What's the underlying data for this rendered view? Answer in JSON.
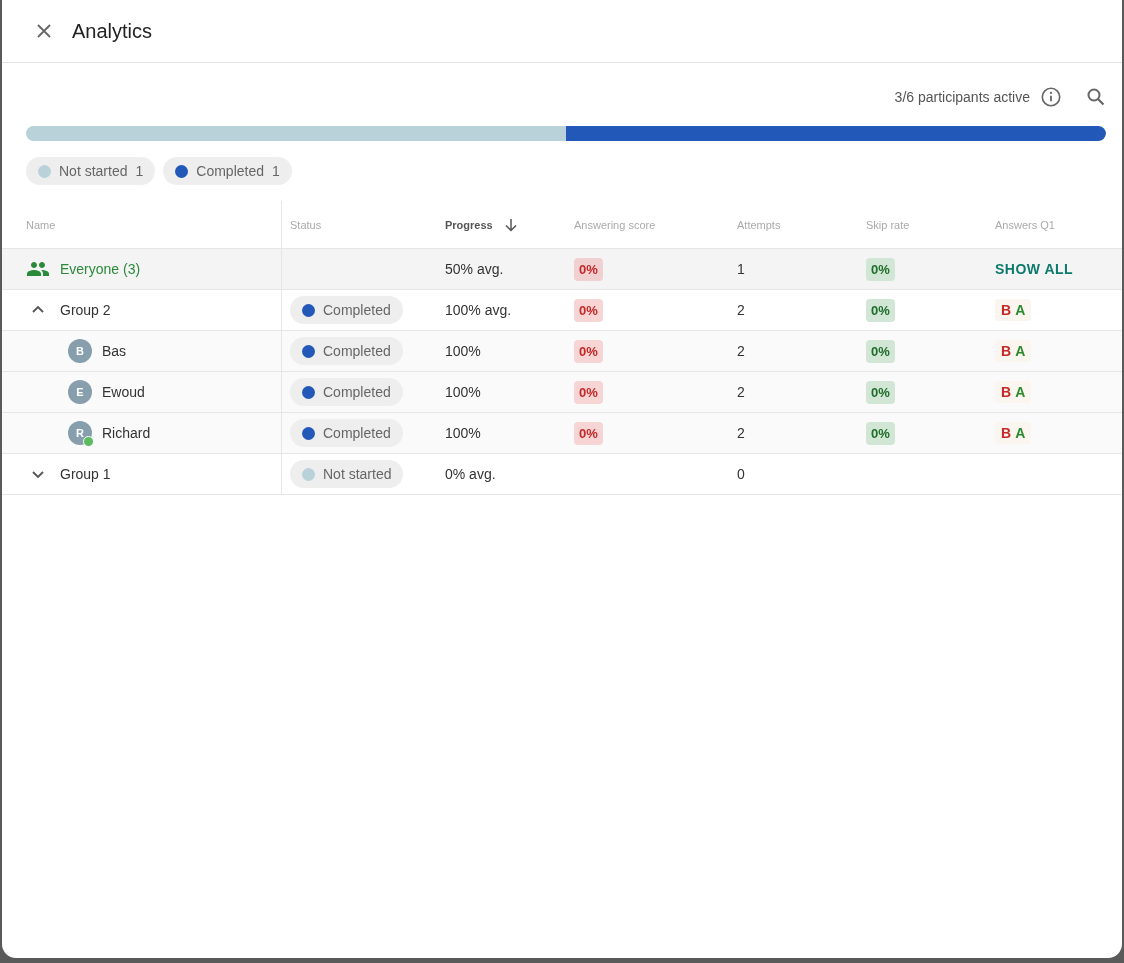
{
  "dialog": {
    "title": "Analytics"
  },
  "participants_active": "3/6 participants active",
  "completed_bar": {
    "level": 0.5
  },
  "legend": [
    {
      "label": "Not started",
      "count": "1",
      "color": "#b9d2da"
    },
    {
      "label": "Completed",
      "count": "1",
      "color": "#2259b9"
    }
  ],
  "table": {
    "columns": [
      {
        "label": "Name",
        "sorted": false
      },
      {
        "label": "Status",
        "sorted": false
      },
      {
        "label": "Progress",
        "sorted": true
      },
      {
        "label": "Answering score",
        "sorted": false
      },
      {
        "label": "Attempts",
        "sorted": false
      },
      {
        "label": "Skip rate",
        "sorted": false
      },
      {
        "label": "Answers Q1",
        "sorted": false
      }
    ],
    "rows": [
      {
        "kind": "everyone",
        "name": "Everyone (3)",
        "progress": "50% avg.",
        "score": "0%",
        "attempts": "1",
        "skip_rate": "0%",
        "answers_link": "SHOW ALL"
      },
      {
        "kind": "group",
        "name": "Group 2",
        "expanded": true,
        "status": {
          "label": "Completed",
          "color": "#2259b9"
        },
        "progress": "100% avg.",
        "score": "0%",
        "attempts": "2",
        "skip_rate": "0%",
        "answers": [
          {
            "letter": "B",
            "correct": false
          },
          {
            "letter": "A",
            "correct": true
          }
        ],
        "children": [
          {
            "kind": "person",
            "initial": "B",
            "name": "Bas",
            "online": false,
            "status": {
              "label": "Completed",
              "color": "#2259b9"
            },
            "progress": "100%",
            "score": "0%",
            "attempts": "2",
            "skip_rate": "0%",
            "answers": [
              {
                "letter": "B",
                "correct": false
              },
              {
                "letter": "A",
                "correct": true
              }
            ]
          },
          {
            "kind": "person",
            "initial": "E",
            "name": "Ewoud",
            "online": false,
            "status": {
              "label": "Completed",
              "color": "#2259b9"
            },
            "progress": "100%",
            "score": "0%",
            "attempts": "2",
            "skip_rate": "0%",
            "answers": [
              {
                "letter": "B",
                "correct": false
              },
              {
                "letter": "A",
                "correct": true
              }
            ]
          },
          {
            "kind": "person",
            "initial": "R",
            "name": "Richard",
            "online": true,
            "status": {
              "label": "Completed",
              "color": "#2259b9"
            },
            "progress": "100%",
            "score": "0%",
            "attempts": "2",
            "skip_rate": "0%",
            "answers": [
              {
                "letter": "B",
                "correct": false
              },
              {
                "letter": "A",
                "correct": true
              }
            ]
          }
        ]
      },
      {
        "kind": "group",
        "name": "Group 1",
        "expanded": false,
        "status": {
          "label": "Not started",
          "color": "#b9d2da"
        },
        "progress": "0% avg.",
        "attempts": "0"
      }
    ]
  }
}
